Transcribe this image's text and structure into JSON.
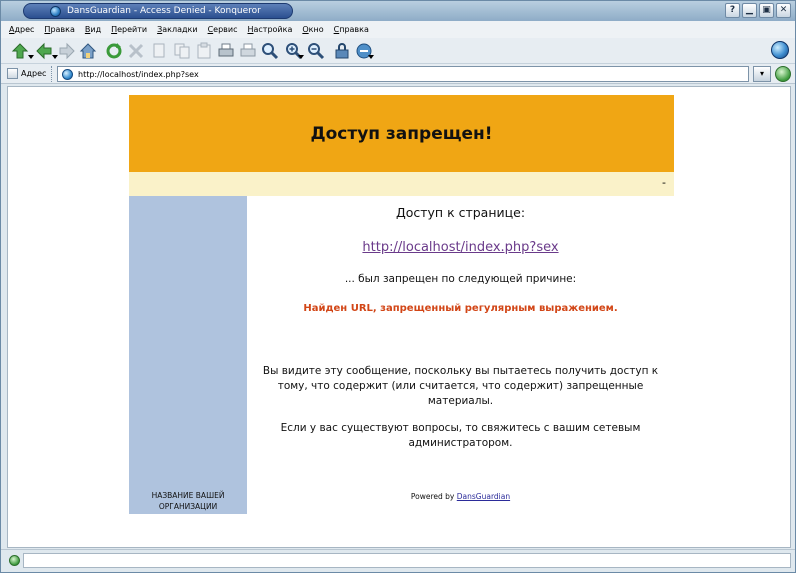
{
  "window": {
    "title": "DansGuardian - Access Denied - Konqueror",
    "buttons": {
      "help": "?",
      "minimize": "▁",
      "maximize": "▣",
      "close": "✕"
    }
  },
  "menubar": {
    "items": [
      {
        "label": "Адрес",
        "key": "А"
      },
      {
        "label": "Правка",
        "key": "П"
      },
      {
        "label": "Вид",
        "key": "В"
      },
      {
        "label": "Перейти",
        "key": "П"
      },
      {
        "label": "Закладки",
        "key": "З"
      },
      {
        "label": "Сервис",
        "key": "С"
      },
      {
        "label": "Настройка",
        "key": "Н"
      },
      {
        "label": "Окно",
        "key": "О"
      },
      {
        "label": "Справка",
        "key": "С"
      }
    ]
  },
  "toolbar": {
    "icons": [
      "up-icon",
      "back-icon",
      "forward-icon",
      "home-icon",
      "reload-icon",
      "stop-icon",
      "cut-icon",
      "copy-icon",
      "paste-icon",
      "print-icon",
      "print-frame-icon",
      "find-icon",
      "zoom-in-icon",
      "zoom-out-icon",
      "security-icon",
      "view-icon"
    ]
  },
  "locationbar": {
    "label": "Адрес",
    "url": "http://localhost/index.php?sex"
  },
  "page": {
    "heading": "Доступ запрещен!",
    "sub_marker": "-",
    "access_to": "Доступ к странице:",
    "blocked_url": "http://localhost/index.php?sex",
    "reason_intro": "... был запрещен по следующей причине:",
    "reason": "Найден URL, запрещенный регулярным выражением.",
    "explanation": "Вы видите эту сообщение, поскольку вы пытаетесь получить доступ к тому, что содержит (или считается, что содержит) запрещенные материалы.",
    "contact": "Если у вас существуют вопросы, то свяжитесь с вашим сетевым администратором.",
    "org_name": "НАЗВАНИЕ ВАШЕЙ ОРГАНИЗАЦИИ",
    "powered_by": "Powered by",
    "powered_link": "DansGuardian"
  },
  "colors": {
    "header": "#f0a614",
    "subheader": "#faf2c9",
    "sidebar": "#afc3de",
    "reason": "#d24617",
    "link": "#6a3a8a"
  },
  "statusbar": {
    "text": ""
  }
}
